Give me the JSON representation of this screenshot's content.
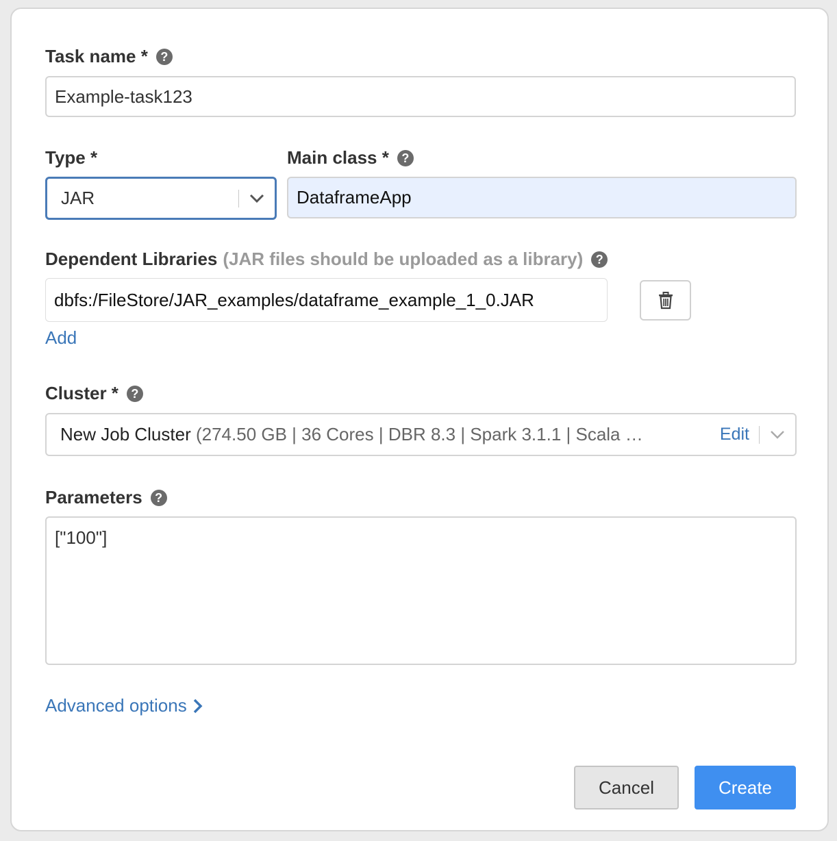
{
  "task_name": {
    "label": "Task name *",
    "value": "Example-task123"
  },
  "type": {
    "label": "Type *",
    "value": "JAR"
  },
  "main_class": {
    "label": "Main class *",
    "value": "DataframeApp"
  },
  "dependent_libraries": {
    "label": "Dependent Libraries",
    "hint": "(JAR files should be uploaded as a library)",
    "items": [
      "dbfs:/FileStore/JAR_examples/dataframe_example_1_0.JAR"
    ],
    "add_label": "Add"
  },
  "cluster": {
    "label": "Cluster *",
    "name": "New Job Cluster",
    "details": "(274.50 GB | 36 Cores | DBR 8.3 | Spark 3.1.1 | Scala …",
    "edit_label": "Edit"
  },
  "parameters": {
    "label": "Parameters",
    "value": "[\"100\"]"
  },
  "advanced_options": {
    "label": "Advanced options"
  },
  "buttons": {
    "cancel": "Cancel",
    "create": "Create"
  },
  "icons": {
    "help": "question-circle-icon",
    "trash": "trash-icon",
    "chevron_down": "chevron-down-icon",
    "chevron_right": "chevron-right-icon"
  },
  "colors": {
    "accent": "#3f8ff0",
    "link": "#3a76b8",
    "autofill_bg": "#e8f0fe",
    "focus_border": "#4a7bb7"
  }
}
